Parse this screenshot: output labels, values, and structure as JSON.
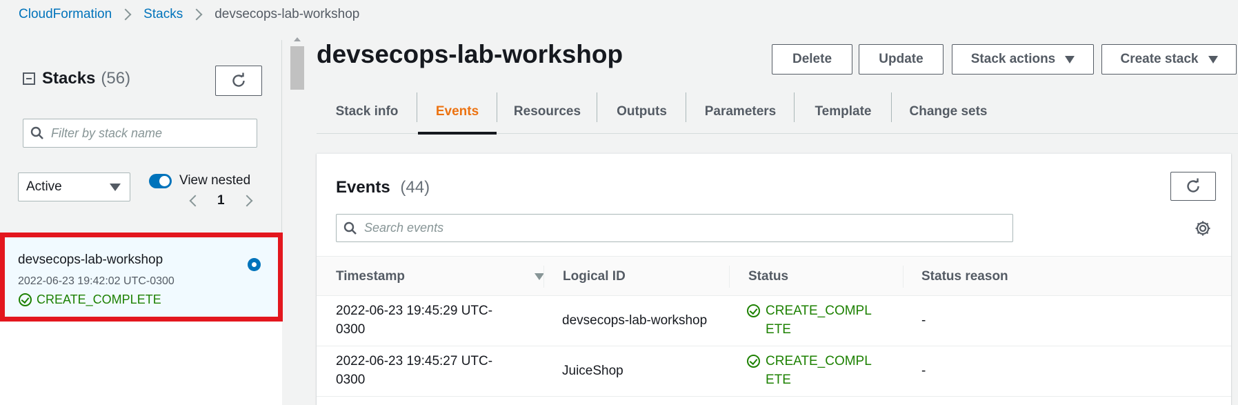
{
  "breadcrumb": [
    {
      "label": "CloudFormation"
    },
    {
      "label": "Stacks"
    },
    {
      "label": "devsecops-lab-workshop"
    }
  ],
  "sidebar": {
    "title": "Stacks",
    "count": "(56)",
    "filter_placeholder": "Filter by stack name",
    "filter_select": "Active",
    "view_nested_label": "View nested",
    "view_nested_on": true,
    "page": "1",
    "stacks": [
      {
        "name": "devsecops-lab-workshop",
        "timestamp": "2022-06-23 19:42:02 UTC-0300",
        "status": "CREATE_COMPLETE",
        "selected": true
      }
    ]
  },
  "main": {
    "stack_title": "devsecops-lab-workshop",
    "actions": {
      "delete": "Delete",
      "update": "Update",
      "stack_actions": "Stack actions",
      "create_stack": "Create stack"
    },
    "tabs": [
      {
        "label": "Stack info"
      },
      {
        "label": "Events"
      },
      {
        "label": "Resources"
      },
      {
        "label": "Outputs"
      },
      {
        "label": "Parameters"
      },
      {
        "label": "Template"
      },
      {
        "label": "Change sets"
      }
    ],
    "active_tab": "Events",
    "events": {
      "title": "Events",
      "count": "(44)",
      "search_placeholder": "Search events",
      "columns": [
        "Timestamp",
        "Logical ID",
        "Status",
        "Status reason"
      ],
      "rows": [
        {
          "timestamp_line1": "2022-06-23 19:45:29 UTC-",
          "timestamp_line2": "0300",
          "logical_id": "devsecops-lab-workshop",
          "status": "CREATE_COMPLETE",
          "status_reason": "-"
        },
        {
          "timestamp_line1": "2022-06-23 19:45:27 UTC-",
          "timestamp_line2": "0300",
          "logical_id": "JuiceShop",
          "status": "CREATE_COMPLETE",
          "status_reason": "-"
        }
      ]
    }
  },
  "colors": {
    "link": "#0073bb",
    "active_tab": "#ec7211",
    "success": "#1d8102",
    "highlight_border": "#e3171e",
    "selected_bg": "#f1faff"
  }
}
